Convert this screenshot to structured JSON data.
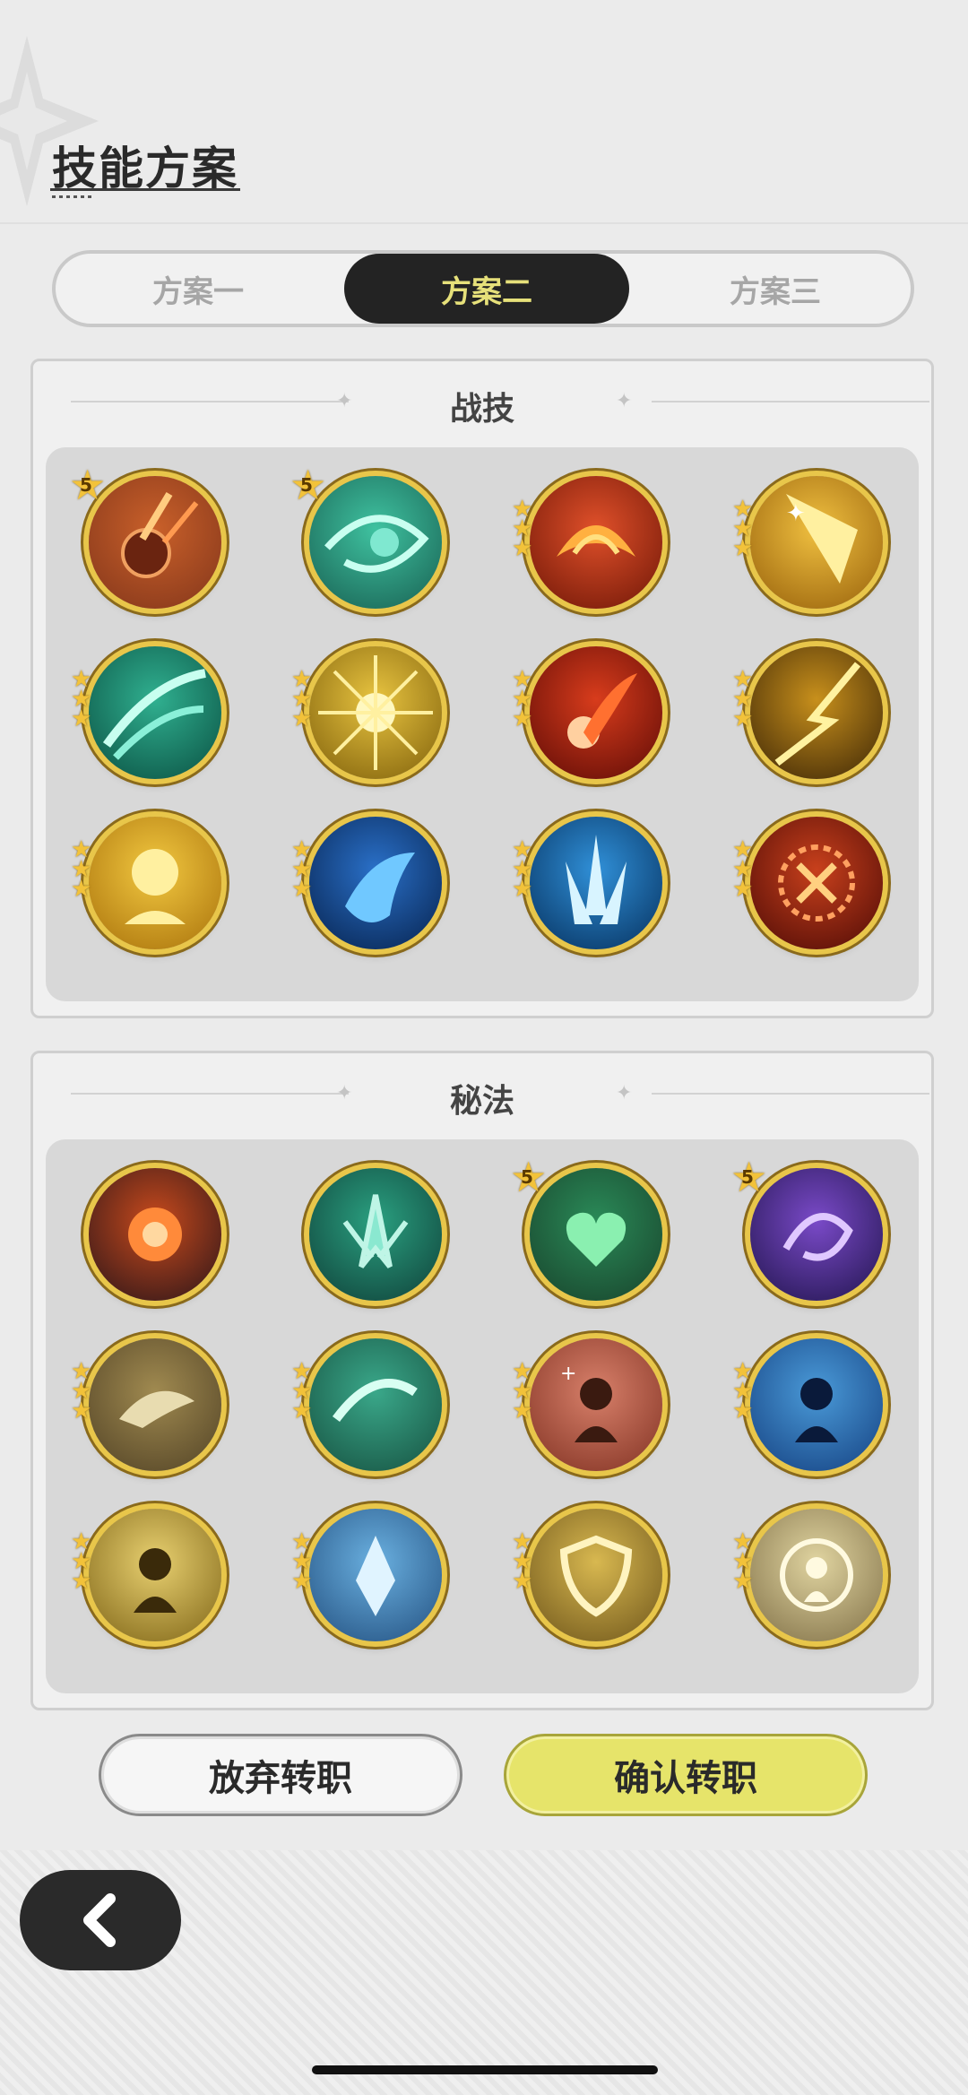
{
  "header": {
    "title": "技能方案"
  },
  "tabs": [
    {
      "label": "方案一",
      "selected": false
    },
    {
      "label": "方案二",
      "selected": true
    },
    {
      "label": "方案三",
      "selected": false
    }
  ],
  "sections": {
    "combat": {
      "title": "战技",
      "skills": [
        {
          "icon": "meteor-skill-icon",
          "badge": "5"
        },
        {
          "icon": "wind-vortex-skill-icon",
          "badge": "5"
        },
        {
          "icon": "fire-burst-skill-icon",
          "stars": 3
        },
        {
          "icon": "holy-light-skill-icon",
          "stars": 3
        },
        {
          "icon": "wind-slash-skill-icon",
          "stars": 3
        },
        {
          "icon": "radiant-burst-skill-icon",
          "stars": 3
        },
        {
          "icon": "fireball-skill-icon",
          "stars": 3
        },
        {
          "icon": "lightning-strike-skill-icon",
          "stars": 3
        },
        {
          "icon": "golden-aura-skill-icon",
          "stars": 3
        },
        {
          "icon": "blue-flame-skill-icon",
          "stars": 3
        },
        {
          "icon": "ice-crystal-skill-icon",
          "stars": 3
        },
        {
          "icon": "fire-explosion-skill-icon",
          "stars": 3
        }
      ]
    },
    "arcane": {
      "title": "秘法",
      "skills": [
        {
          "icon": "flame-orb-arcane-icon"
        },
        {
          "icon": "wind-blades-arcane-icon"
        },
        {
          "icon": "heart-heal-arcane-icon",
          "badge": "5"
        },
        {
          "icon": "shadow-swirl-arcane-icon",
          "badge": "5"
        },
        {
          "icon": "winged-hat-arcane-icon",
          "stars": 3
        },
        {
          "icon": "wind-step-arcane-icon",
          "stars": 3
        },
        {
          "icon": "heal-figure-arcane-icon",
          "stars": 3
        },
        {
          "icon": "water-figure-arcane-icon",
          "stars": 3
        },
        {
          "icon": "light-figure-arcane-icon",
          "stars": 3
        },
        {
          "icon": "ice-shard-arcane-icon",
          "stars": 3
        },
        {
          "icon": "shield-arcane-icon",
          "stars": 3
        },
        {
          "icon": "barrier-figure-arcane-icon",
          "stars": 3
        }
      ]
    }
  },
  "actions": {
    "cancel_label": "放弃转职",
    "confirm_label": "确认转职"
  },
  "colors": {
    "accent_yellow": "#e6e46a",
    "tab_active_bg": "#232323",
    "tab_active_text": "#e6e07a",
    "gold_ring": "#e8c64a"
  }
}
